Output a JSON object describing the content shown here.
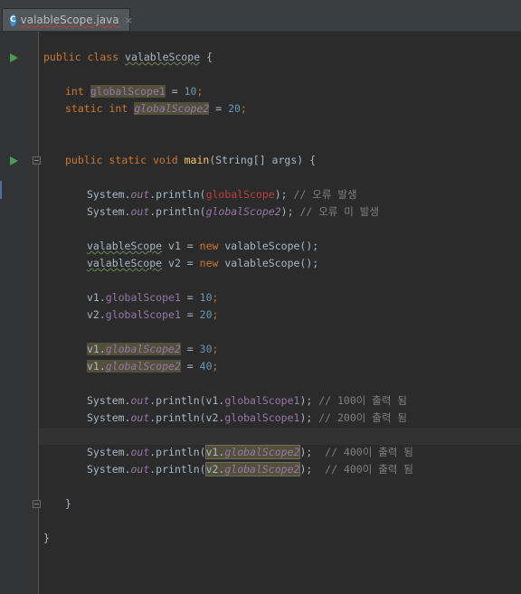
{
  "tab": {
    "icon": "C",
    "filename": "valableScope.java",
    "close": "×"
  },
  "code": {
    "l1": [
      "public",
      "class",
      "valableScope",
      "{"
    ],
    "l2": [
      "int",
      "globalScope1",
      "=",
      "10",
      ";"
    ],
    "l3": [
      "static",
      "int",
      "globalScope2",
      "=",
      "20",
      ";"
    ],
    "l4": [
      "public",
      "static",
      "void",
      "main",
      "(String[] args) {"
    ],
    "l5": [
      "System.",
      "out",
      ".println(",
      "globalScope",
      ");",
      "// 오류 발생"
    ],
    "l6": [
      "System.",
      "out",
      ".println(",
      "globalScope2",
      ");",
      "// 오류 미 발생"
    ],
    "l7": [
      "valableScope",
      " v1 = ",
      "new",
      " valableScope();"
    ],
    "l8": [
      "valableScope",
      " v2 = ",
      "new",
      " valableScope();"
    ],
    "l9": [
      "v1.",
      "globalScope1",
      " = ",
      "10",
      ";"
    ],
    "l10": [
      "v2.",
      "globalScope1",
      " = ",
      "20",
      ";"
    ],
    "l11": [
      "v1.",
      "globalScope2",
      " = ",
      "30",
      ";"
    ],
    "l12": [
      "v1.",
      "globalScope2",
      " = ",
      "40",
      ";"
    ],
    "l13": [
      "System.",
      "out",
      ".println(v1.",
      "globalScope1",
      ");",
      "// 100이 출력 됨"
    ],
    "l14": [
      "System.",
      "out",
      ".println(v2.",
      "globalScope1",
      ");",
      "// 200이 출력 됨"
    ],
    "l15": [
      "System.",
      "out",
      ".println(",
      "v1.",
      "globalScope2",
      ");",
      "// 400이 출력 됨"
    ],
    "l16": [
      "System.",
      "out",
      ".println(",
      "v2.",
      "globalScope2",
      ");",
      "// 400이 출력 됨"
    ],
    "l17": "}",
    "l18": "}"
  },
  "icons": {
    "run": "run-icon",
    "fold": "fold-icon",
    "file": "java-class-icon"
  },
  "colors": {
    "background": "#2b2b2b",
    "gutter": "#313335",
    "keyword": "#cc7832",
    "number": "#6897bb",
    "field": "#9876aa",
    "error": "#bc3f3c",
    "comment": "#808080",
    "method": "#ffc66d",
    "text": "#a9b7c6"
  }
}
